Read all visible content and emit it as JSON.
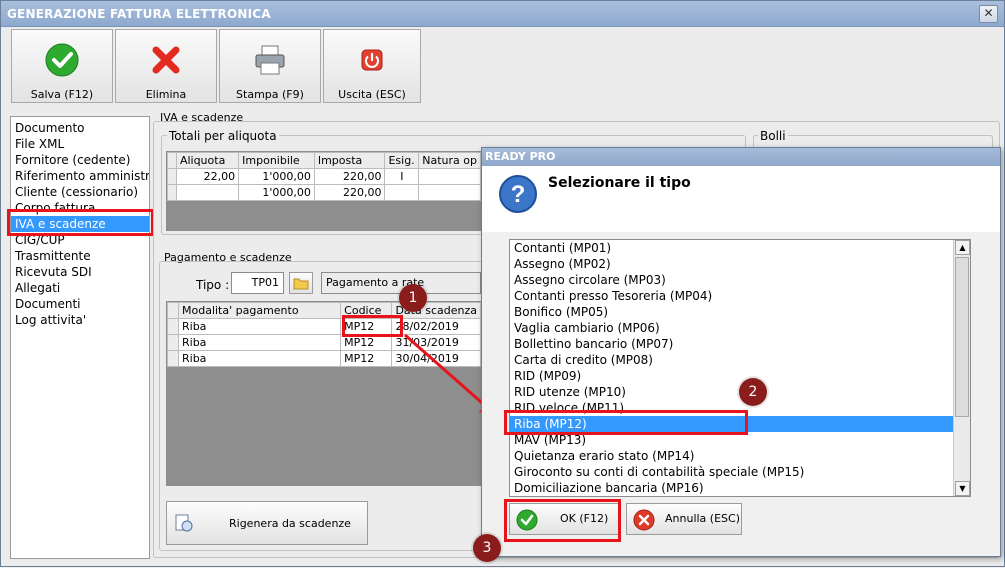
{
  "window": {
    "title": "GENERAZIONE FATTURA ELETTRONICA",
    "close_glyph": "✕"
  },
  "toolbar": {
    "save_label": "Salva (F12)",
    "delete_label": "Elimina",
    "print_label": "Stampa (F9)",
    "exit_label": "Uscita (ESC)"
  },
  "sidebar": {
    "items": [
      {
        "label": "Documento"
      },
      {
        "label": "File XML"
      },
      {
        "label": "Fornitore (cedente)"
      },
      {
        "label": "Riferimento amministrativo"
      },
      {
        "label": "Cliente (cessionario)"
      },
      {
        "label": "Corpo fattura"
      },
      {
        "label": "IVA e scadenze"
      },
      {
        "label": "CIG/CUP"
      },
      {
        "label": "Trasmittente"
      },
      {
        "label": "Ricevuta SDI"
      },
      {
        "label": "Allegati"
      },
      {
        "label": "Documenti"
      },
      {
        "label": "Log attivita'"
      }
    ]
  },
  "iva": {
    "group_title": "IVA e scadenze",
    "totals_title": "Totali per aliquota",
    "bolli_title": "Bolli",
    "columns": [
      "Aliquota",
      "Imponibile",
      "Imposta",
      "Esig.",
      "Natura op"
    ],
    "rows": [
      [
        "22,00",
        "1'000,00",
        "220,00",
        "I",
        ""
      ],
      [
        "",
        "1'000,00",
        "220,00",
        "",
        ""
      ]
    ]
  },
  "payment": {
    "group_title": "Pagamento e scadenze",
    "tipo_label": "Tipo :",
    "tipo_value": "TP01",
    "tipo_desc": "Pagamento a rate",
    "columns": [
      "Modalita' pagamento",
      "Codice",
      "Data scadenza"
    ],
    "rows": [
      [
        "Riba",
        "MP12",
        "28/02/2019"
      ],
      [
        "Riba",
        "MP12",
        "31/03/2019"
      ],
      [
        "Riba",
        "MP12",
        "30/04/2019"
      ]
    ],
    "regen_label": "Rigenera da scadenze"
  },
  "dialog": {
    "title": "READY PRO",
    "heading": "Selezionare il tipo",
    "options": [
      {
        "label": "Contanti (MP01)"
      },
      {
        "label": "Assegno (MP02)"
      },
      {
        "label": "Assegno circolare (MP03)"
      },
      {
        "label": "Contanti presso Tesoreria (MP04)"
      },
      {
        "label": "Bonifico (MP05)"
      },
      {
        "label": "Vaglia cambiario (MP06)"
      },
      {
        "label": "Bollettino bancario (MP07)"
      },
      {
        "label": "Carta di credito (MP08)"
      },
      {
        "label": "RID (MP09)"
      },
      {
        "label": "RID utenze (MP10)"
      },
      {
        "label": "RID veloce (MP11)"
      },
      {
        "label": "Riba (MP12)"
      },
      {
        "label": "MAV (MP13)"
      },
      {
        "label": "Quietanza erario stato (MP14)"
      },
      {
        "label": "Giroconto su conti di contabilità speciale (MP15)"
      },
      {
        "label": "Domiciliazione bancaria (MP16)"
      }
    ],
    "selected_option": "Riba (MP12)",
    "ok_label": "OK (F12)",
    "cancel_label": "Annulla (ESC)"
  },
  "annotations": [
    "1",
    "2",
    "3"
  ],
  "colors": {
    "accent": "#3399ff",
    "highlight": "#e8141b",
    "badge": "#8a1c1c"
  }
}
